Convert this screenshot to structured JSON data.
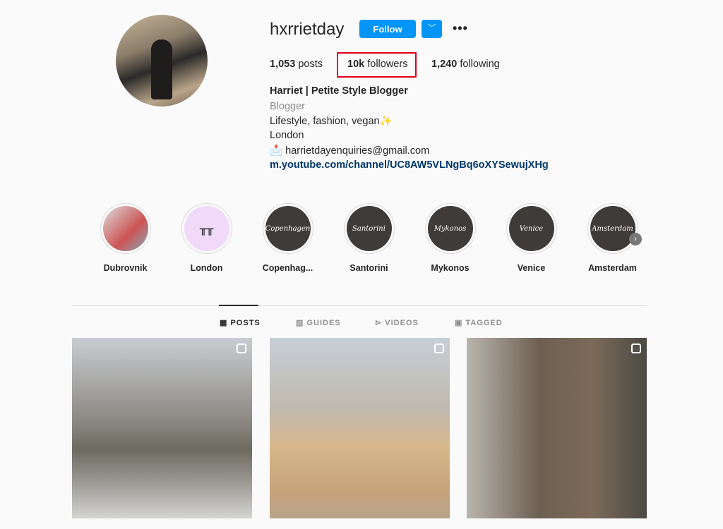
{
  "profile": {
    "username": "hxrrietday",
    "follow_label": "Follow",
    "more_label": "•••",
    "stats": {
      "posts_count": "1,053",
      "posts_label": "posts",
      "followers_count": "10k",
      "followers_label": "followers",
      "following_count": "1,240",
      "following_label": "following"
    },
    "bio": {
      "name": "Harriet | Petite Style Blogger",
      "category": "Blogger",
      "line1": "Lifestyle, fashion, vegan✨",
      "line2": "London",
      "email": "📩 harrietdayenquiries@gmail.com",
      "link": "m.youtube.com/channel/UC8AW5VLNgBq6oXYSewujXHg"
    }
  },
  "highlights": [
    {
      "label": "Dubrovnik",
      "cover": ""
    },
    {
      "label": "London",
      "cover": ""
    },
    {
      "label": "Copenhag...",
      "cover": "Copenhagen"
    },
    {
      "label": "Santorini",
      "cover": "Santorini"
    },
    {
      "label": "Mykonos",
      "cover": "Mykonos"
    },
    {
      "label": "Venice",
      "cover": "Venice"
    },
    {
      "label": "Amsterdam",
      "cover": "Amsterdam"
    }
  ],
  "tabs": [
    {
      "label": "POSTS",
      "icon": "grid-icon",
      "active": true
    },
    {
      "label": "GUIDES",
      "icon": "guide-icon"
    },
    {
      "label": "VIDEOS",
      "icon": "play-icon"
    },
    {
      "label": "TAGGED",
      "icon": "tag-icon"
    }
  ],
  "posts": [
    {
      "type": "reel"
    },
    {
      "type": "reel"
    },
    {
      "type": "carousel"
    }
  ],
  "colors": {
    "accent": "#0095f6",
    "highlight_box": "#e0001b",
    "link": "#00376b"
  }
}
